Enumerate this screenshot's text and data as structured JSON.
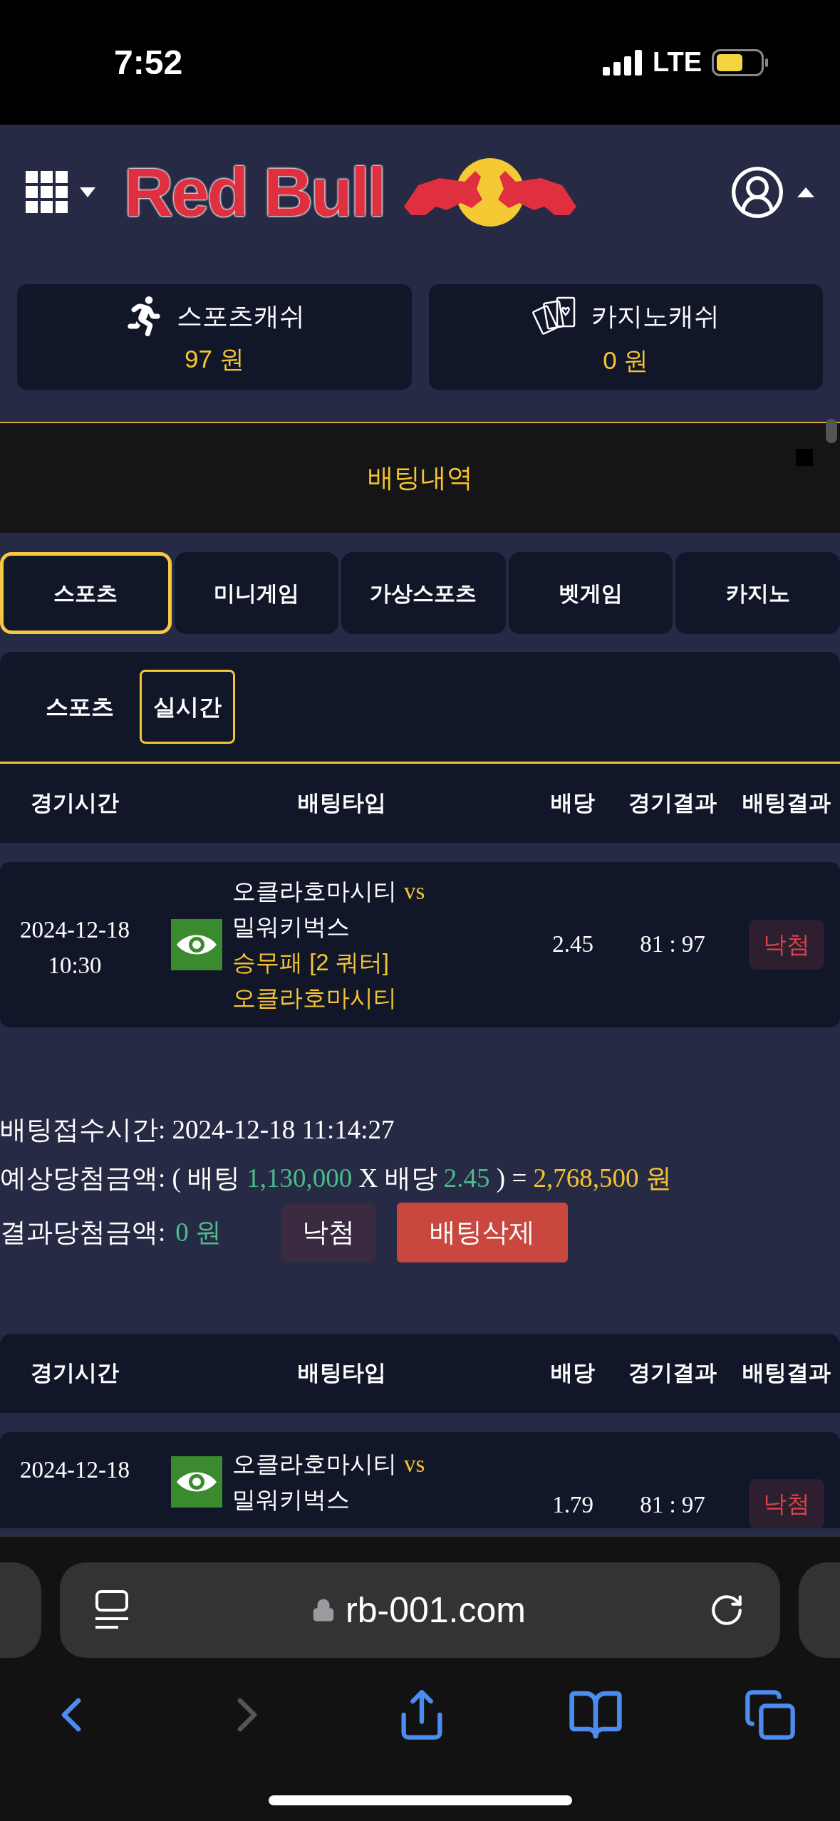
{
  "status_bar": {
    "time": "7:52",
    "network": "LTE"
  },
  "header": {
    "logo_text": "Red Bull"
  },
  "wallets": [
    {
      "kind": "sports",
      "label": "스포츠캐쉬",
      "amount": "97 원"
    },
    {
      "kind": "casino",
      "label": "카지노캐쉬",
      "amount": "0 원"
    }
  ],
  "page_title": "배팅내역",
  "tabs": [
    {
      "label": "스포츠",
      "selected": true
    },
    {
      "label": "미니게임",
      "selected": false
    },
    {
      "label": "가상스포츠",
      "selected": false
    },
    {
      "label": "벳게임",
      "selected": false
    },
    {
      "label": "카지노",
      "selected": false
    }
  ],
  "sub_tabs": [
    {
      "label": "스포츠",
      "selected": false
    },
    {
      "label": "실시간",
      "selected": true
    }
  ],
  "bets": [
    {
      "columns": [
        "경기시간",
        "배팅타입",
        "배당",
        "경기결과",
        "배팅결과"
      ],
      "row": {
        "date": "2024-12-18",
        "time": "10:30",
        "home": "오클라호마시티",
        "vs": "vs",
        "away": "밀워키벅스",
        "market": "승무패 [2 쿼터]",
        "pick": "오클라호마시티",
        "odds": "2.45",
        "score": "81 : 97",
        "result": "낙첨"
      },
      "info": {
        "received": "배팅접수시간: 2024-12-18 11:14:27",
        "expected": [
          {
            "kind": "plain",
            "text": "예상당첨금액: ( 배팅"
          },
          {
            "kind": "value",
            "text": "1,130,000"
          },
          {
            "kind": "plain",
            "text": "X 배당"
          },
          {
            "kind": "value",
            "text": "2.45"
          },
          {
            "kind": "plain",
            "text": ") ="
          },
          {
            "kind": "total",
            "text": "2,768,500 원"
          }
        ],
        "result_label": "결과당첨금액:",
        "result_amount": "0 원",
        "status": "낙첨",
        "delete_button": "배팅삭제"
      }
    },
    {
      "columns": [
        "경기시간",
        "배팅타입",
        "배당",
        "경기결과",
        "배팅결과"
      ],
      "row": {
        "date": "2024-12-18",
        "home": "오클라호마시티",
        "vs": "vs",
        "away": "밀워키벅스",
        "odds": "1.79",
        "score": "81 : 97",
        "result": "낙첨"
      }
    }
  ],
  "browser": {
    "url": "rb-001.com",
    "forward_enabled": false
  }
}
